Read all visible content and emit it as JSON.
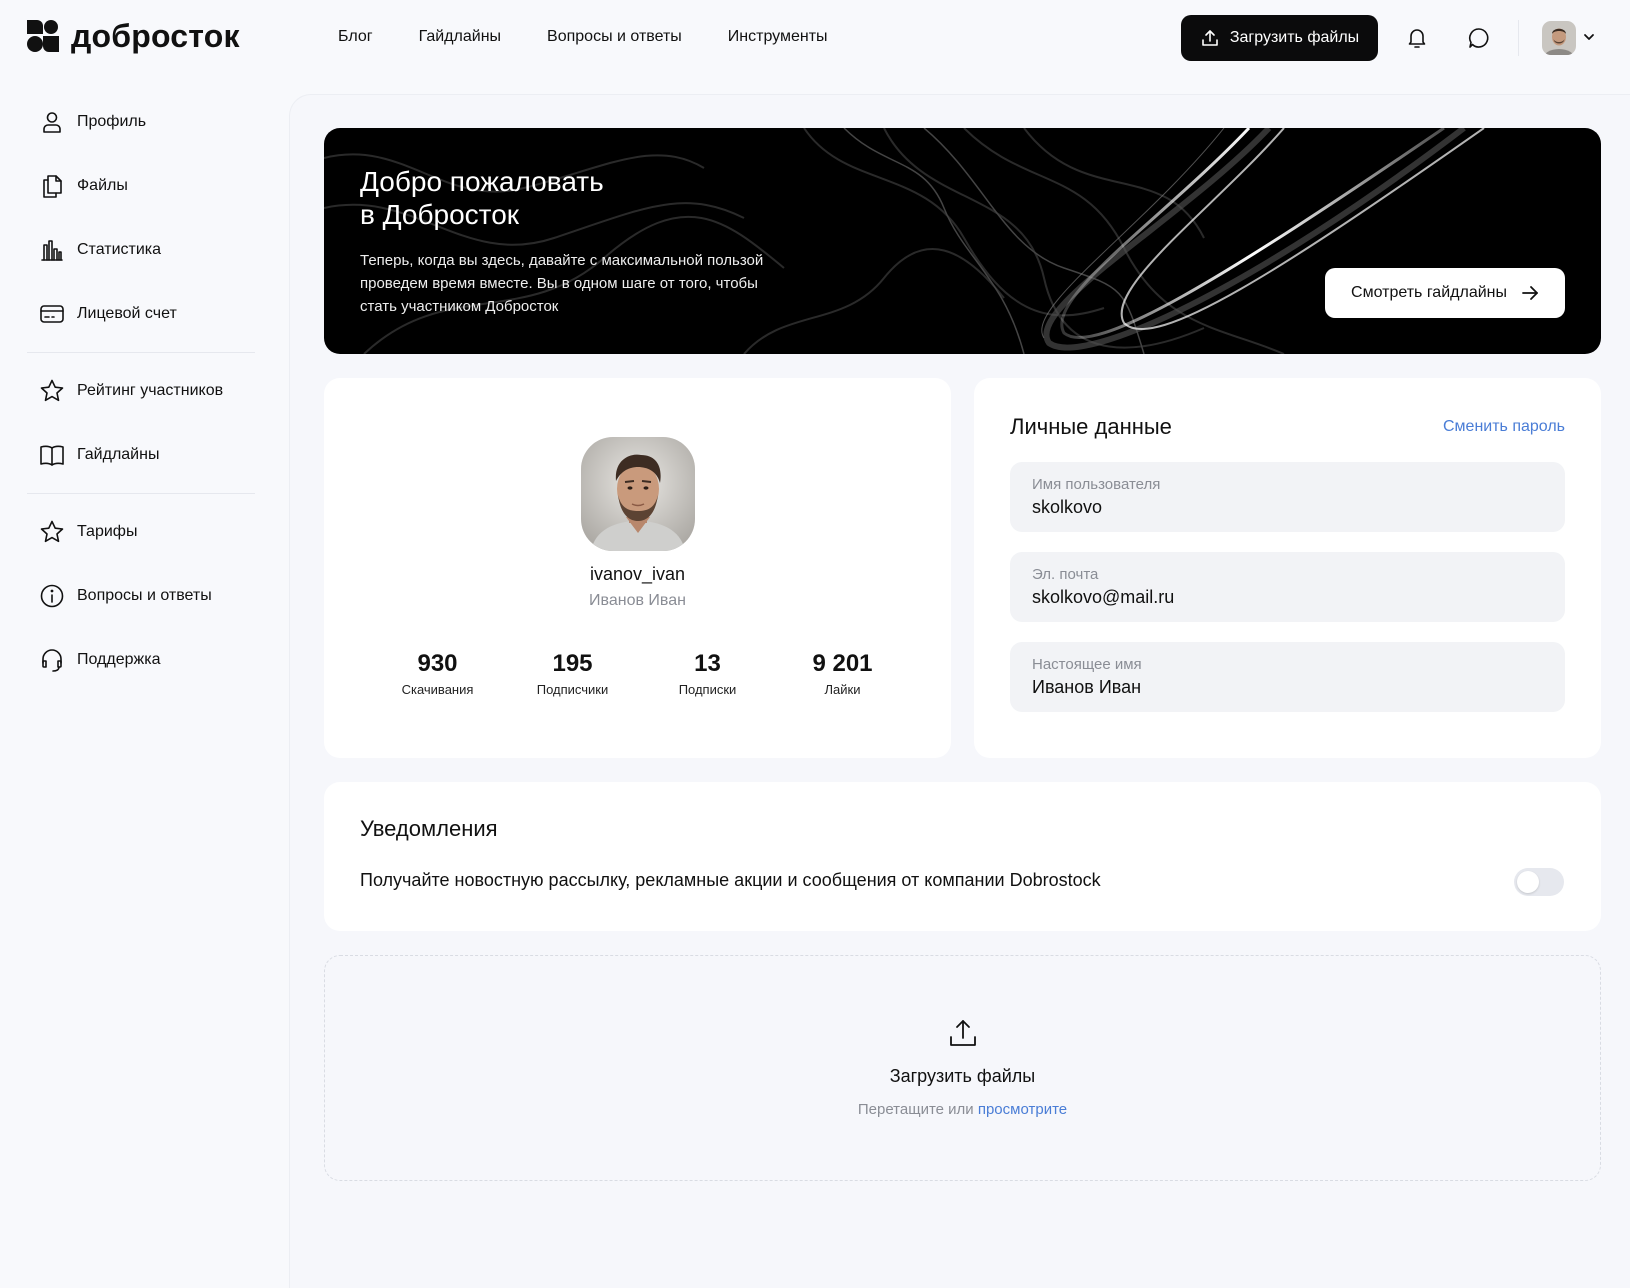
{
  "header": {
    "logo_text": "добросток",
    "nav": [
      "Блог",
      "Гайдлайны",
      "Вопросы и ответы",
      "Инструменты"
    ],
    "upload_label": "Загрузить файлы",
    "icons": [
      "upload-icon",
      "bell-icon",
      "chat-icon",
      "chevron-down-icon"
    ]
  },
  "sidebar": {
    "groups": [
      [
        {
          "label": "Профиль",
          "icon": "user-icon"
        },
        {
          "label": "Файлы",
          "icon": "files-icon"
        },
        {
          "label": "Статистика",
          "icon": "bar-chart-icon"
        },
        {
          "label": "Лицевой счет",
          "icon": "card-icon"
        }
      ],
      [
        {
          "label": "Рейтинг участников",
          "icon": "star-icon"
        },
        {
          "label": "Гайдлайны",
          "icon": "book-icon"
        }
      ],
      [
        {
          "label": "Тарифы",
          "icon": "star-icon"
        },
        {
          "label": "Вопросы и ответы",
          "icon": "info-icon"
        },
        {
          "label": "Поддержка",
          "icon": "headset-icon"
        }
      ]
    ]
  },
  "banner": {
    "title_line1": "Добро пожаловать",
    "title_line2": "в Добросток",
    "text": "Теперь, когда вы здесь, давайте с максимальной пользой проведем время вместе. Вы в одном шаге от того, чтобы стать участником Добросток",
    "button_label": "Смотреть гайдлайны"
  },
  "profile": {
    "username": "ivanov_ivan",
    "real_name": "Иванов Иван",
    "stats": [
      {
        "value": "930",
        "label": "Скачивания"
      },
      {
        "value": "195",
        "label": "Подписчики"
      },
      {
        "value": "13",
        "label": "Подписки"
      },
      {
        "value": "9 201",
        "label": "Лайки"
      }
    ]
  },
  "personal": {
    "title": "Личные данные",
    "change_password": "Сменить пароль",
    "fields": [
      {
        "label": "Имя пользователя",
        "value": "skolkovo"
      },
      {
        "label": "Эл. почта",
        "value": "skolkovo@mail.ru"
      },
      {
        "label": "Настоящее имя",
        "value": "Иванов Иван"
      }
    ]
  },
  "notifications": {
    "title": "Уведомления",
    "text": "Получайте новостную рассылку, рекламные акции и сообщения от компании Dobrostock",
    "toggle_on": false
  },
  "dropzone": {
    "title": "Загрузить файлы",
    "sub_prefix": "Перетащите или",
    "sub_link": "просмотрите"
  },
  "colors": {
    "accent_link": "#4a7dd6",
    "primary_button": "#0b0b0c",
    "background": "#f8f9fc"
  }
}
